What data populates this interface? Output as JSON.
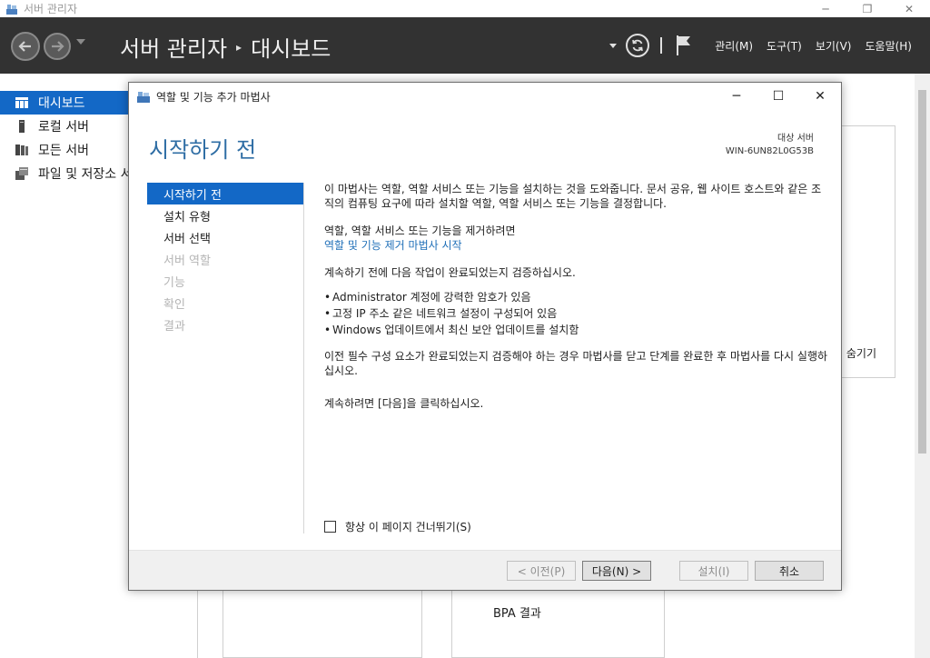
{
  "window": {
    "title": "서버 관리자",
    "controls": {
      "minimize": "─",
      "maximize": "❐",
      "close": "✕"
    }
  },
  "header": {
    "breadcrumb_root": "서버 관리자",
    "breadcrumb_sep": "▸",
    "breadcrumb_page": "대시보드",
    "menus": [
      "관리(M)",
      "도구(T)",
      "보기(V)",
      "도움말(H)"
    ]
  },
  "sidebar": {
    "items": [
      {
        "label": "대시보드",
        "icon": "dashboard-icon",
        "active": true
      },
      {
        "label": "로컬 서버",
        "icon": "server-icon",
        "active": false
      },
      {
        "label": "모든 서버",
        "icon": "servers-icon",
        "active": false
      },
      {
        "label": "파일 및 저장소 서비스",
        "icon": "storage-icon",
        "active": false
      }
    ]
  },
  "background": {
    "hide_label": "숨기기",
    "bpa_label": "BPA 결과",
    "partial_label": "BPA 결과"
  },
  "dialog": {
    "title": "역할 및 기능 추가 마법사",
    "controls": {
      "minimize": "─",
      "maximize": "☐",
      "close": "✕"
    },
    "heading": "시작하기 전",
    "target_server_label": "대상 서버",
    "target_server_name": "WIN-6UN82L0G53B",
    "steps": [
      {
        "label": "시작하기 전",
        "state": "active"
      },
      {
        "label": "설치 유형",
        "state": "normal"
      },
      {
        "label": "서버 선택",
        "state": "normal"
      },
      {
        "label": "서버 역할",
        "state": "disabled"
      },
      {
        "label": "기능",
        "state": "disabled"
      },
      {
        "label": "확인",
        "state": "disabled"
      },
      {
        "label": "결과",
        "state": "disabled"
      }
    ],
    "intro": "이 마법사는 역할, 역할 서비스 또는 기능을 설치하는 것을 도와줍니다. 문서 공유, 웹 사이트 호스트와 같은 조직의 컴퓨팅 요구에 따라 설치할 역할, 역할 서비스 또는 기능을 결정합니다.",
    "remove_text": "역할, 역할 서비스 또는 기능을 제거하려면",
    "remove_link": "역할 및 기능 제거 마법사 시작",
    "verify_text": "계속하기 전에 다음 작업이 완료되었는지 검증하십시오.",
    "checklist": [
      "Administrator 계정에 강력한 암호가 있음",
      "고정 IP 주소 같은 네트워크 설정이 구성되어 있음",
      "Windows 업데이트에서 최신 보안 업데이트를 설치함"
    ],
    "prereq_text": "이전 필수 구성 요소가 완료되었는지 검증해야 하는 경우 마법사를 닫고 단계를 완료한 후 마법사를 다시 실행하십시오.",
    "continue_text": "계속하려면 [다음]을 클릭하십시오.",
    "skip_label": "항상 이 페이지 건너뛰기(S)",
    "skip_checked": false,
    "buttons": {
      "previous": "< 이전(P)",
      "next": "다음(N) >",
      "install": "설치(I)",
      "cancel": "취소"
    }
  },
  "colors": {
    "header_bg": "#323232",
    "accent_blue": "#1368c6",
    "heading_blue": "#2e6da4",
    "link_blue": "#1f6fb8"
  }
}
